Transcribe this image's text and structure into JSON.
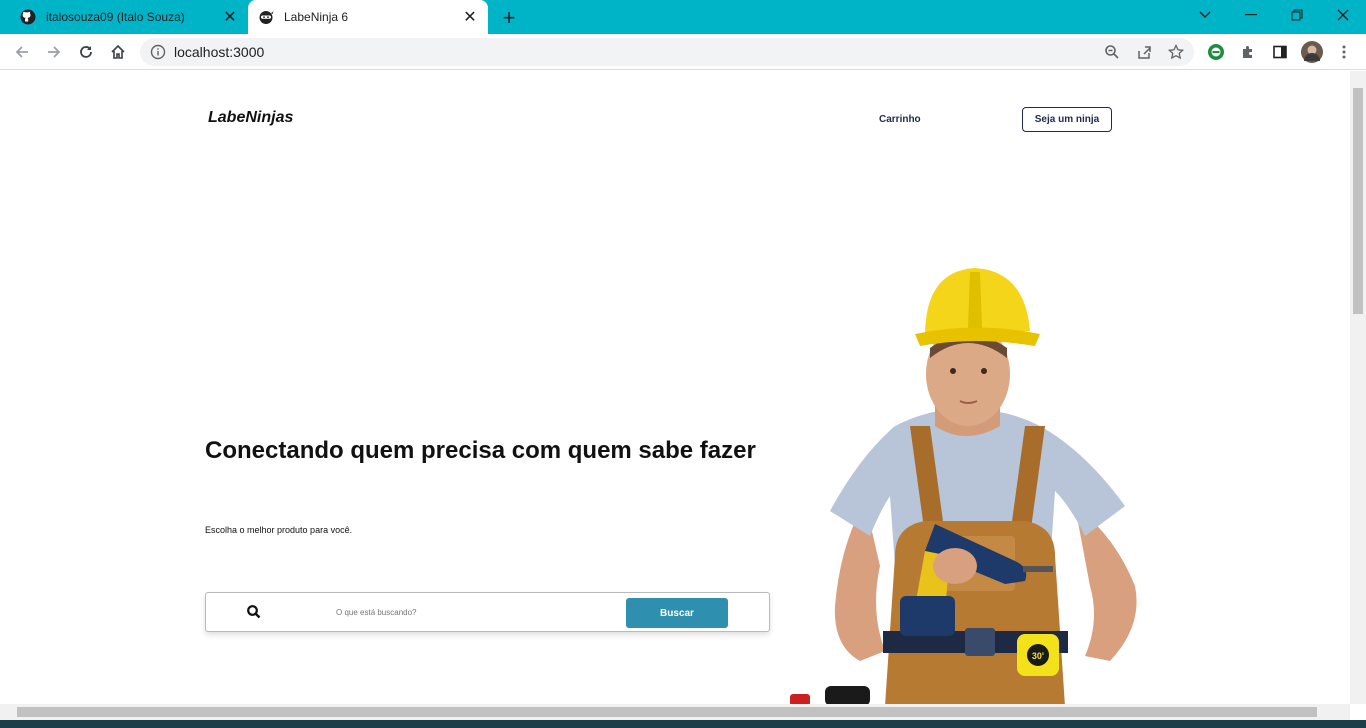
{
  "browser": {
    "tabs": [
      {
        "title": "italosouza09 (Italo Souza)",
        "icon": "github-icon",
        "active": false
      },
      {
        "title": "LabeNinja 6",
        "icon": "ninja-icon",
        "active": true
      }
    ],
    "url": "localhost:3000"
  },
  "header": {
    "logo": "LabeNinjas",
    "cart_label": "Carrinho",
    "ninja_button": "Seja um ninja"
  },
  "hero": {
    "headline": "Conectando quem precisa com quem sabe fazer",
    "subline": "Escolha o melhor produto para você.",
    "image": "construction-worker-with-drill"
  },
  "search": {
    "placeholder": "O que está buscando?",
    "button": "Buscar"
  },
  "colors": {
    "tabbar": "#00b4c8",
    "primary_button": "#2e8fae",
    "nav_text": "#1d2b4f",
    "helmet": "#f5d51a",
    "overalls": "#b77a33"
  }
}
